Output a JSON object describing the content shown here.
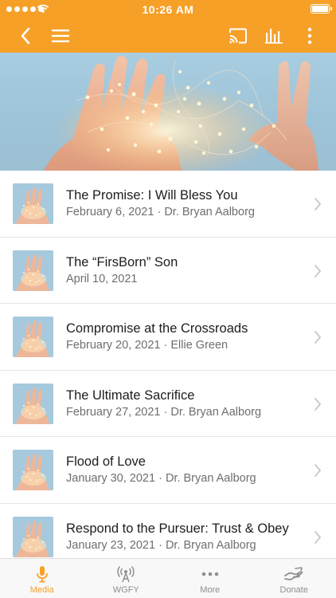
{
  "status_bar": {
    "time": "10:26 AM"
  },
  "icons": {
    "back": "chevron-left-icon",
    "menu": "hamburger-menu-icon",
    "cast": "cast-icon",
    "audio": "audio-bars-icon",
    "more": "more-vertical-icon"
  },
  "colors": {
    "accent": "#f6a028",
    "tab_inactive": "#8e8e93"
  },
  "sermons": [
    {
      "title": "The Promise: I Will Bless You",
      "subtitle": "February 6, 2021 · Dr. Bryan Aalborg"
    },
    {
      "title": "The “FirsBorn” Son",
      "subtitle": "April 10, 2021"
    },
    {
      "title": "Compromise at the Crossroads",
      "subtitle": "February 20, 2021 · Ellie Green"
    },
    {
      "title": "The Ultimate Sacrifice",
      "subtitle": "February 27, 2021 · Dr. Bryan Aalborg"
    },
    {
      "title": "Flood of Love",
      "subtitle": "January 30, 2021 · Dr. Bryan Aalborg"
    },
    {
      "title": "Respond to the Pursuer: Trust & Obey",
      "subtitle": "January 23, 2021 · Dr. Bryan Aalborg"
    }
  ],
  "tabs": [
    {
      "label": "Media",
      "icon": "microphone-icon",
      "active": true
    },
    {
      "label": "WGFY",
      "icon": "radio-tower-icon",
      "active": false
    },
    {
      "label": "More",
      "icon": "ellipsis-icon",
      "active": false
    },
    {
      "label": "Donate",
      "icon": "donate-hand-icon",
      "active": false
    }
  ]
}
